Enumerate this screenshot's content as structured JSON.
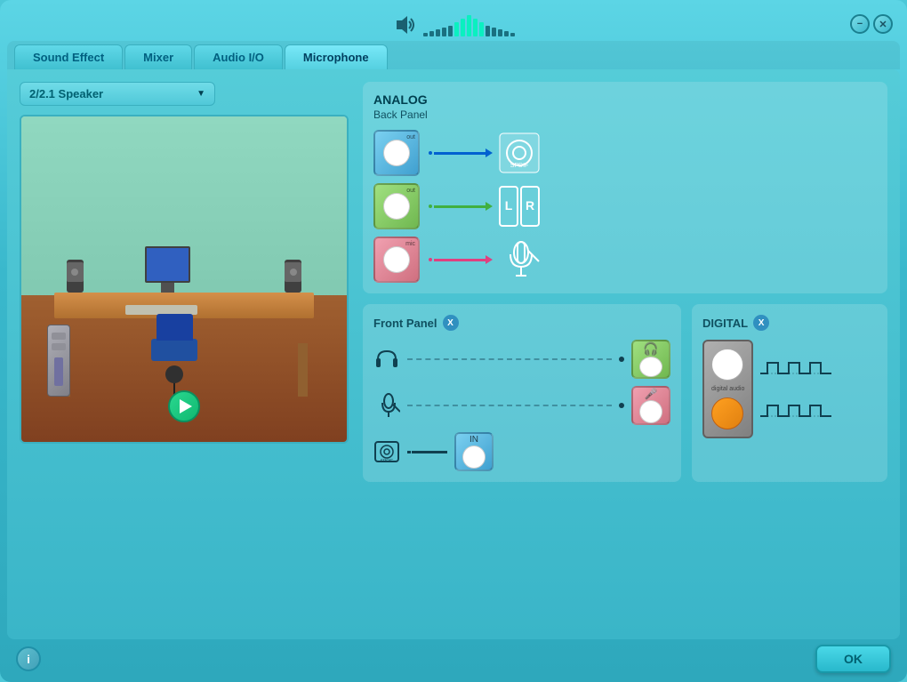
{
  "window": {
    "minimize_label": "−",
    "close_label": "✕"
  },
  "tabs": [
    {
      "id": "sound-effect",
      "label": "Sound Effect"
    },
    {
      "id": "mixer",
      "label": "Mixer"
    },
    {
      "id": "audio-io",
      "label": "Audio I/O"
    },
    {
      "id": "microphone",
      "label": "Microphone"
    }
  ],
  "active_tab": "microphone",
  "speaker_dropdown": {
    "value": "2/2.1 Speaker",
    "arrow": "▼"
  },
  "analog": {
    "title": "ANALOG",
    "subtitle": "Back Panel",
    "ports": [
      {
        "color": "blue",
        "label": "out"
      },
      {
        "color": "green",
        "label": "out"
      },
      {
        "color": "pink",
        "label": "mic"
      }
    ]
  },
  "front_panel": {
    "title": "Front Panel",
    "badge": "X"
  },
  "digital": {
    "title": "DIGITAL",
    "badge": "X",
    "label": "digital audio"
  },
  "bottom": {
    "ok_label": "OK",
    "info_label": "i"
  },
  "volume_bars": [
    2,
    3,
    4,
    5,
    6,
    8,
    10,
    12,
    10,
    8,
    6,
    5,
    4,
    3,
    2
  ]
}
